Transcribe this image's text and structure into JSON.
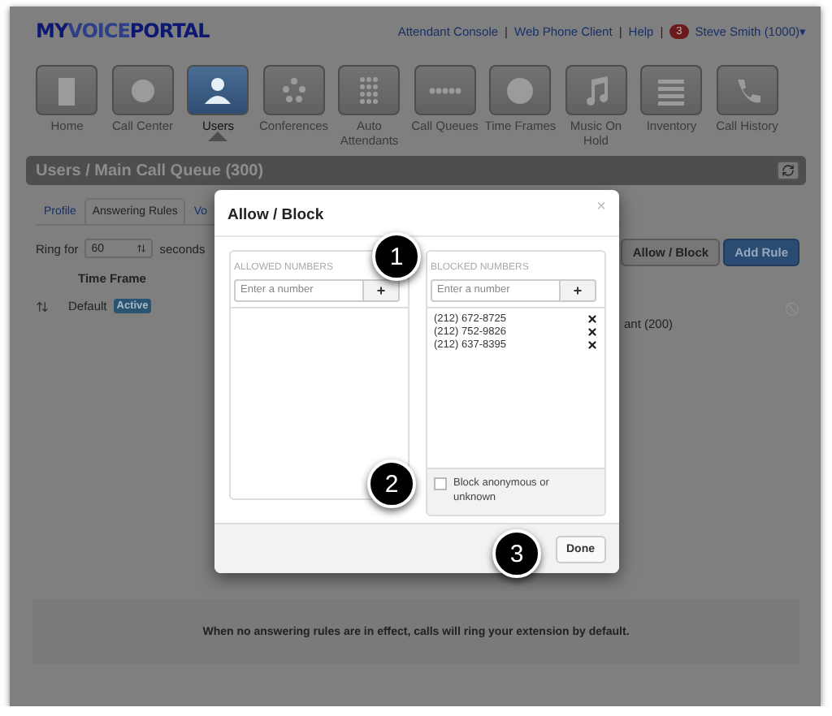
{
  "logo": [
    "MY",
    "VOICE",
    "PORTAL"
  ],
  "top_links": [
    "Attendant Console",
    "Web Phone Client",
    "Help"
  ],
  "separator": "|",
  "user": {
    "badge": "3",
    "name": "Steve Smith (1000)",
    "caret": "▾"
  },
  "nav": [
    {
      "label": "Home",
      "selected": false
    },
    {
      "label": "Call Center",
      "selected": false
    },
    {
      "label": "Users",
      "selected": true
    },
    {
      "label": "Conferences",
      "selected": false
    },
    {
      "label": "Auto Attendants",
      "selected": false
    },
    {
      "label": "Call Queues",
      "selected": false
    },
    {
      "label": "Time Frames",
      "selected": false
    },
    {
      "label": "Music On Hold",
      "selected": false
    },
    {
      "label": "Inventory",
      "selected": false
    },
    {
      "label": "Call History",
      "selected": false
    }
  ],
  "header": {
    "breadcrumb": "Users / Main Call Queue (300)"
  },
  "tabs": [
    {
      "label": "Profile",
      "selected": false
    },
    {
      "label": "Answering Rules",
      "selected": true
    },
    {
      "label": "Vo",
      "selected": false
    }
  ],
  "ring": {
    "label": "Ring for",
    "value": "60",
    "unit": "seconds"
  },
  "buttons": [
    "Allow / Block",
    "Add Rule"
  ],
  "rules": {
    "column": "Time Frame",
    "rows": [
      {
        "name": "Default",
        "badge": "Active",
        "column_2": "ant (200)"
      }
    ]
  },
  "footer_note": "When no answering rules are in effect, calls will ring your extension by default.",
  "dialog": {
    "title": "Allow / Block",
    "close": "×",
    "allowed": {
      "heading": "ALLOWED NUMBERS",
      "placeholder": "Enter a number",
      "add": "+"
    },
    "blocked": {
      "heading": "BLOCKED NUMBERS",
      "placeholder": "Enter a number",
      "add": "+",
      "numbers": [
        "(212) 672-8725",
        "(212) 752-9826",
        "(212) 637-8395"
      ]
    },
    "block_anonymous": {
      "label": "Block anonymous or unknown",
      "checked": false
    },
    "done": "Done"
  },
  "callouts": [
    "1",
    "2",
    "3"
  ]
}
